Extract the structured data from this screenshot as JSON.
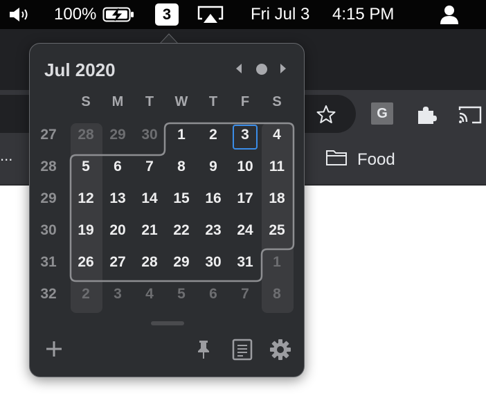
{
  "menubar": {
    "icons": [
      "speaker-icon",
      "battery-charging-icon",
      "airplay-icon",
      "user-icon"
    ],
    "battery_percent": "100%",
    "calendar_badge": "3",
    "date": "Fri Jul 3",
    "time": "4:15 PM"
  },
  "browser": {
    "bookmarks_overflow": "...",
    "bookmark_folder": "Food",
    "extension_letter": "G",
    "icons": [
      "star-icon",
      "grammarly-icon",
      "puzzle-icon",
      "cast-icon",
      "folder-icon"
    ]
  },
  "calendar": {
    "title": "Jul 2020",
    "nav_icons": [
      "chevron-left-icon",
      "today-dot-icon",
      "chevron-right-icon"
    ],
    "weekdays": [
      "S",
      "M",
      "T",
      "W",
      "T",
      "F",
      "S"
    ],
    "weeks": [
      {
        "week": "27",
        "days": [
          {
            "d": "28",
            "o": true
          },
          {
            "d": "29",
            "o": true
          },
          {
            "d": "30",
            "o": true
          },
          {
            "d": "1",
            "o": false
          },
          {
            "d": "2",
            "o": false
          },
          {
            "d": "3",
            "o": false
          },
          {
            "d": "4",
            "o": false
          }
        ]
      },
      {
        "week": "28",
        "days": [
          {
            "d": "5",
            "o": false
          },
          {
            "d": "6",
            "o": false
          },
          {
            "d": "7",
            "o": false
          },
          {
            "d": "8",
            "o": false
          },
          {
            "d": "9",
            "o": false
          },
          {
            "d": "10",
            "o": false
          },
          {
            "d": "11",
            "o": false
          }
        ]
      },
      {
        "week": "29",
        "days": [
          {
            "d": "12",
            "o": false
          },
          {
            "d": "13",
            "o": false
          },
          {
            "d": "14",
            "o": false
          },
          {
            "d": "15",
            "o": false
          },
          {
            "d": "16",
            "o": false
          },
          {
            "d": "17",
            "o": false
          },
          {
            "d": "18",
            "o": false
          }
        ]
      },
      {
        "week": "30",
        "days": [
          {
            "d": "19",
            "o": false
          },
          {
            "d": "20",
            "o": false
          },
          {
            "d": "21",
            "o": false
          },
          {
            "d": "22",
            "o": false
          },
          {
            "d": "23",
            "o": false
          },
          {
            "d": "24",
            "o": false
          },
          {
            "d": "25",
            "o": false
          }
        ]
      },
      {
        "week": "31",
        "days": [
          {
            "d": "26",
            "o": false
          },
          {
            "d": "27",
            "o": false
          },
          {
            "d": "28",
            "o": false
          },
          {
            "d": "29",
            "o": false
          },
          {
            "d": "30",
            "o": false
          },
          {
            "d": "31",
            "o": false
          },
          {
            "d": "1",
            "o": true
          }
        ]
      },
      {
        "week": "32",
        "days": [
          {
            "d": "2",
            "o": true
          },
          {
            "d": "3",
            "o": true
          },
          {
            "d": "4",
            "o": true
          },
          {
            "d": "5",
            "o": true
          },
          {
            "d": "6",
            "o": true
          },
          {
            "d": "7",
            "o": true
          },
          {
            "d": "8",
            "o": true
          }
        ]
      }
    ],
    "today": "3",
    "footer_icons": [
      "add-icon",
      "pin-icon",
      "notes-icon",
      "gear-icon"
    ],
    "colors": {
      "today_outline": "#3b8de8",
      "popover_bg": "#2c2e31",
      "weekend_shade": "#3b3c3f"
    }
  }
}
